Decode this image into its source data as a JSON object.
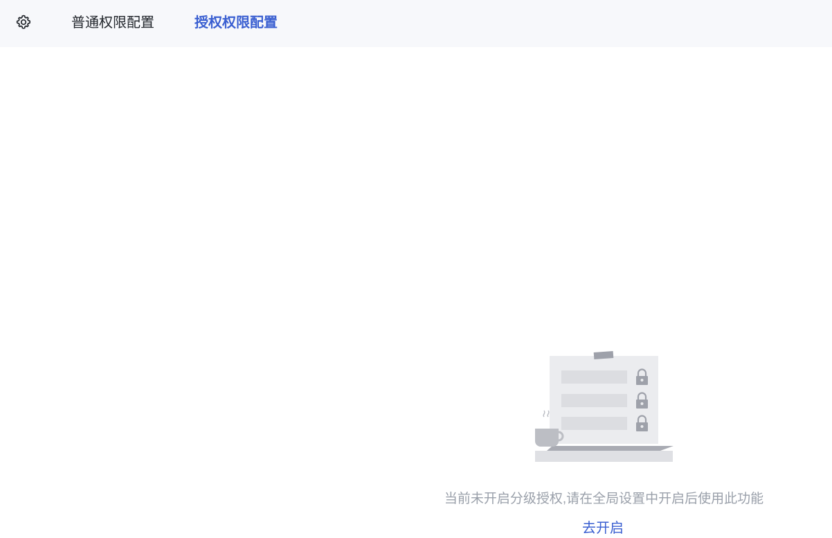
{
  "header": {
    "settings_icon": "gear-icon",
    "tabs": [
      {
        "label": "普通权限配置",
        "active": false
      },
      {
        "label": "授权权限配置",
        "active": true
      }
    ],
    "background": "#f7f8fb",
    "accent_color": "#3a5fd1"
  },
  "empty_state": {
    "illustration": "locked-document-with-coffee-cup",
    "message": "当前未开启分级授权,请在全局设置中开启后使用此功能",
    "action_label": "去开启"
  }
}
